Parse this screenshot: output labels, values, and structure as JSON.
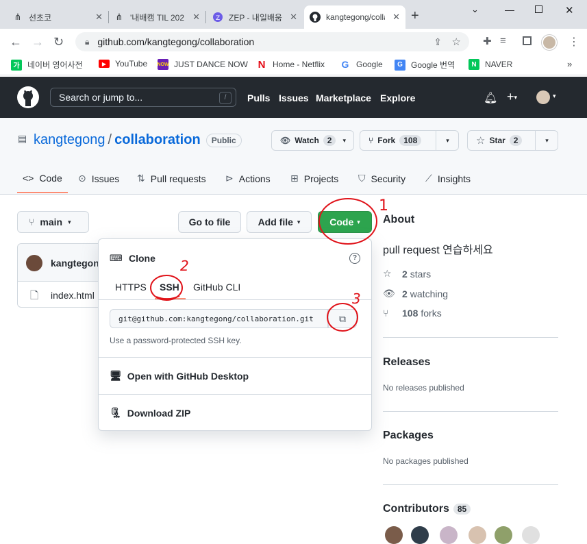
{
  "browser": {
    "tabs": [
      {
        "label": "선초코",
        "icon": "github-branch-icon"
      },
      {
        "label": "'내배캠 TIL 202",
        "icon": "github-branch-icon"
      },
      {
        "label": "ZEP - 내일배움",
        "icon": "zep-icon"
      },
      {
        "label": "kangtegong/colla",
        "icon": "github-icon",
        "active": true
      }
    ],
    "url": "github.com/kangtegong/collaboration",
    "bookmarks": [
      {
        "label": "네이버 영어사전",
        "color": "#03c75a",
        "glyph": "가"
      },
      {
        "label": "YouTube",
        "color": "#ff0000",
        "glyph": "▶"
      },
      {
        "label": "JUST DANCE NOW",
        "color": "#6a1fb5",
        "glyph": "N"
      },
      {
        "label": "Home - Netflix",
        "color": "#e50914",
        "glyph": "N"
      },
      {
        "label": "Google",
        "color": "#4285f4",
        "glyph": "G"
      },
      {
        "label": "Google 번역",
        "color": "#4285f4",
        "glyph": "G"
      },
      {
        "label": "NAVER",
        "color": "#03c75a",
        "glyph": "N"
      }
    ]
  },
  "github": {
    "search_placeholder": "Search or jump to...",
    "search_shortcut": "/",
    "nav": [
      "Pulls",
      "Issues",
      "Marketplace",
      "Explore"
    ]
  },
  "repo": {
    "owner": "kangtegong",
    "separator": "/",
    "name": "collaboration",
    "visibility": "Public",
    "watch_label": "Watch",
    "watch_count": "2",
    "fork_label": "Fork",
    "fork_count": "108",
    "star_label": "Star",
    "star_count": "2",
    "tabs": [
      "Code",
      "Issues",
      "Pull requests",
      "Actions",
      "Projects",
      "Security",
      "Insights"
    ],
    "active_tab": "Code"
  },
  "main": {
    "branch": "main",
    "go_to_file": "Go to file",
    "add_file": "Add file",
    "code_button": "Code",
    "commit_author": "kangtegon",
    "files": [
      "index.html"
    ]
  },
  "clone": {
    "title": "Clone",
    "tabs": [
      "HTTPS",
      "SSH",
      "GitHub CLI"
    ],
    "active_tab": "SSH",
    "url": "git@github.com:kangtegong/collaboration.git",
    "hint": "Use a password-protected SSH key.",
    "open_desktop": "Open with GitHub Desktop",
    "download_zip": "Download ZIP"
  },
  "about": {
    "heading": "About",
    "description": "pull request 연습하세요",
    "stars_count": "2",
    "stars_label": "stars",
    "watching_count": "2",
    "watching_label": "watching",
    "forks_count": "108",
    "forks_label": "forks",
    "releases_heading": "Releases",
    "releases_text": "No releases published",
    "packages_heading": "Packages",
    "packages_text": "No packages published",
    "contributors_heading": "Contributors",
    "contributors_count": "85"
  },
  "annotations": [
    "1",
    "2",
    "3"
  ],
  "colors": {
    "accent_green": "#2da44e",
    "link_blue": "#0969da",
    "header_dark": "#24292f",
    "annotation_red": "#e0131a"
  }
}
